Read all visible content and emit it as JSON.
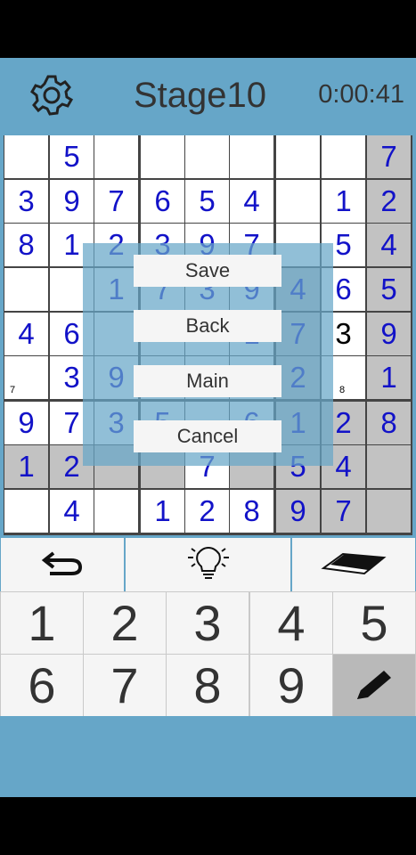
{
  "header": {
    "title": "Stage10",
    "timer": "0:00:41",
    "settings_icon": "gear-icon"
  },
  "board": {
    "digits": [
      [
        "",
        "5",
        "",
        "",
        "",
        "",
        "",
        "",
        "7"
      ],
      [
        "3",
        "9",
        "7",
        "6",
        "5",
        "4",
        "",
        "1",
        "2"
      ],
      [
        "8",
        "1",
        "2",
        "3",
        "9",
        "7",
        "",
        "5",
        "4"
      ],
      [
        "",
        "",
        "1",
        "7",
        "3",
        "9",
        "4",
        "6",
        "5"
      ],
      [
        "4",
        "6",
        "",
        "",
        "",
        "1",
        "7",
        "3",
        "9"
      ],
      [
        "",
        "3",
        "9",
        "",
        "",
        "",
        "2",
        "",
        "1"
      ],
      [
        "9",
        "7",
        "3",
        "5",
        "",
        "6",
        "1",
        "2",
        "8"
      ],
      [
        "1",
        "2",
        "",
        "",
        "7",
        "",
        "5",
        "4",
        ""
      ],
      [
        "",
        "4",
        "",
        "1",
        "2",
        "8",
        "9",
        "7",
        ""
      ]
    ],
    "notes": {
      "r5c0": "7",
      "r5c7": "8"
    },
    "black_cell": "r4c7",
    "gray_cells": [
      "r0c8",
      "r1c8",
      "r2c8",
      "r3c8",
      "r4c8",
      "r5c8",
      "r6c8",
      "r7c0",
      "r7c1",
      "r7c2",
      "r7c3",
      "r7c5",
      "r7c6",
      "r7c7",
      "r7c8",
      "r8c6",
      "r8c7",
      "r8c8",
      "r6c6",
      "r6c7",
      "r5c6",
      "r4c6",
      "r3c6"
    ]
  },
  "menu": {
    "save": "Save",
    "back": "Back",
    "main": "Main",
    "cancel": "Cancel"
  },
  "tools": {
    "undo_icon": "undo-icon",
    "hint_icon": "lightbulb-icon",
    "erase_icon": "eraser-icon"
  },
  "keypad": {
    "keys": [
      "1",
      "2",
      "3",
      "4",
      "5",
      "6",
      "7",
      "8",
      "9"
    ],
    "pencil_icon": "pencil-icon"
  },
  "colors": {
    "bar": "#66a6c8",
    "digit_blue": "#1212c8",
    "gray_cell": "#c2c2c2"
  }
}
